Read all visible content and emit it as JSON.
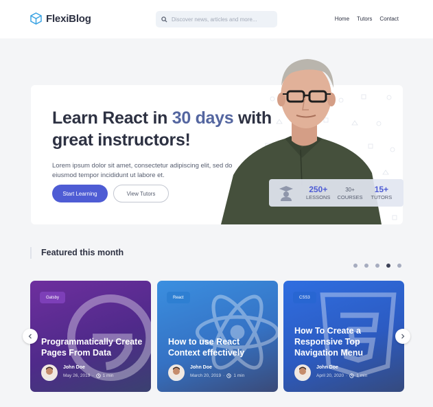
{
  "brand": {
    "name": "FlexiBlog"
  },
  "search": {
    "placeholder": "Discover news, articles and more..."
  },
  "nav": {
    "items": [
      "Home",
      "Tutors",
      "Contact"
    ]
  },
  "hero": {
    "title_start": "Learn React in ",
    "title_accent": "30 days",
    "title_end": " with great instructors!",
    "description": "Lorem ipsum dolor sit amet, consectetur adipiscing elit, sed do eiusmod tempor incididunt ut labore et.",
    "primary_button": "Start Learning",
    "secondary_button": "View Tutors",
    "stats": [
      {
        "value": "250+",
        "label": "LESSONS"
      },
      {
        "value": "30+",
        "label": "COURSES"
      },
      {
        "value": "15+",
        "label": "TUTORS"
      }
    ]
  },
  "featured": {
    "heading": "Featured this month",
    "carousel_dots": 5,
    "active_dot": 3,
    "cards": [
      {
        "tag": "Gatsby",
        "title": "Programmatically Create Pages From Data",
        "author": "John Doe",
        "date": "May 26, 2019",
        "read": "1 min"
      },
      {
        "tag": "React",
        "title": "How to use React Context effectively",
        "author": "John Doe",
        "date": "March 20, 2019",
        "read": "1 min"
      },
      {
        "tag": "CSS3",
        "title": "How To Create a Responsive Top Navigation Menu",
        "author": "John Doe",
        "date": "April 20, 2020",
        "read": "1 min"
      }
    ]
  },
  "colors": {
    "accent": "#4e5cd4",
    "accent_text": "#5466a0",
    "card_gatsby": "#663399",
    "card_react": "#3a8ed8",
    "card_css": "#2f6fd6"
  }
}
